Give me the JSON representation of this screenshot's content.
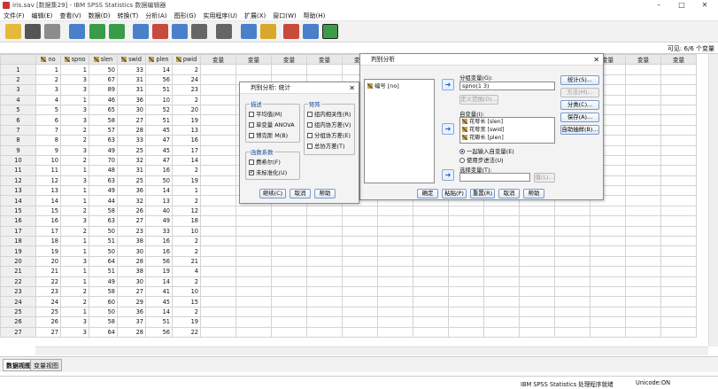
{
  "window": {
    "title": "iris.sav [数据集29] - IBM SPSS Statistics 数据编辑器"
  },
  "menu": [
    "文件(F)",
    "编辑(E)",
    "查看(V)",
    "数据(D)",
    "转换(T)",
    "分析(A)",
    "图形(G)",
    "实用程序(U)",
    "扩展(X)",
    "窗口(W)",
    "帮助(H)"
  ],
  "editbar": {
    "visible": "可见: 6/6 个变量"
  },
  "grid": {
    "columns": [
      "no",
      "spno",
      "slen",
      "swid",
      "plen",
      "pwid"
    ],
    "empty_header": "变量",
    "rows": [
      [
        1,
        1,
        50,
        33,
        14,
        2
      ],
      [
        2,
        3,
        67,
        31,
        56,
        24
      ],
      [
        3,
        3,
        89,
        31,
        51,
        23
      ],
      [
        4,
        1,
        46,
        36,
        10,
        2
      ],
      [
        5,
        3,
        65,
        30,
        52,
        20
      ],
      [
        6,
        3,
        58,
        27,
        51,
        19
      ],
      [
        7,
        2,
        57,
        28,
        45,
        13
      ],
      [
        8,
        2,
        63,
        33,
        47,
        16
      ],
      [
        9,
        3,
        49,
        25,
        45,
        17
      ],
      [
        10,
        2,
        70,
        32,
        47,
        14
      ],
      [
        11,
        1,
        48,
        31,
        16,
        2
      ],
      [
        12,
        3,
        63,
        25,
        50,
        19
      ],
      [
        13,
        1,
        49,
        36,
        14,
        1
      ],
      [
        14,
        1,
        44,
        32,
        13,
        2
      ],
      [
        15,
        2,
        58,
        26,
        40,
        12
      ],
      [
        16,
        3,
        63,
        27,
        49,
        18
      ],
      [
        17,
        2,
        50,
        23,
        33,
        10
      ],
      [
        18,
        1,
        51,
        38,
        16,
        2
      ],
      [
        19,
        1,
        50,
        30,
        16,
        2
      ],
      [
        20,
        3,
        64,
        28,
        56,
        21
      ],
      [
        21,
        1,
        51,
        38,
        19,
        4
      ],
      [
        22,
        1,
        49,
        30,
        14,
        2
      ],
      [
        23,
        2,
        58,
        27,
        41,
        10
      ],
      [
        24,
        2,
        60,
        29,
        45,
        15
      ],
      [
        25,
        1,
        50,
        36,
        14,
        2
      ],
      [
        26,
        3,
        58,
        37,
        51,
        19
      ],
      [
        27,
        3,
        64,
        28,
        56,
        22
      ]
    ]
  },
  "tabs": {
    "data_view": "数据视图",
    "variable_view": "变量视图"
  },
  "statusbar": {
    "processor": "IBM SPSS Statistics 处理程序就绪",
    "unicode": "Unicode:ON"
  },
  "discriminant_dialog": {
    "title": "判别分析",
    "source_var": "编号 [no]",
    "grouping_label": "分组变量(G):",
    "grouping_value": "spno(1 3)",
    "define_range": "定义范围(D)...",
    "independents_label": "自变量(I):",
    "independents": [
      "花萼长 [slen]",
      "花萼宽 [swid]",
      "花瓣长 [plen]"
    ],
    "enter_together": "一起输入自变量(E)",
    "use_stepwise": "使用步进法(U)",
    "selection_label": "选择变量(T):",
    "value_btn": "值(L)...",
    "side_buttons": [
      "统计(S)...",
      "方法(M)...",
      "分类(C)...",
      "保存(A)...",
      "自助抽样(B)..."
    ],
    "bottom_buttons": [
      "确定",
      "粘贴(P)",
      "重置(R)",
      "取消",
      "帮助"
    ]
  },
  "stats_dialog": {
    "title": "判别分析: 统计",
    "descriptives_title": "描述",
    "descriptives": [
      {
        "label": "平均值(M)",
        "checked": false
      },
      {
        "label": "单变量 ANOVA",
        "checked": false
      },
      {
        "label": "博克斯 M(B)",
        "checked": false
      }
    ],
    "matrices_title": "矩阵",
    "matrices": [
      {
        "label": "组内相关性(R)",
        "checked": false
      },
      {
        "label": "组内协方差(V)",
        "checked": false
      },
      {
        "label": "分组协方差(E)",
        "checked": false
      },
      {
        "label": "总协方差(T)",
        "checked": false
      }
    ],
    "coefficients_title": "函数系数",
    "coefficients": [
      {
        "label": "费希尔(F)",
        "checked": false
      },
      {
        "label": "未标准化(U)",
        "checked": true
      }
    ],
    "buttons": [
      "继续(C)",
      "取消",
      "帮助"
    ]
  }
}
